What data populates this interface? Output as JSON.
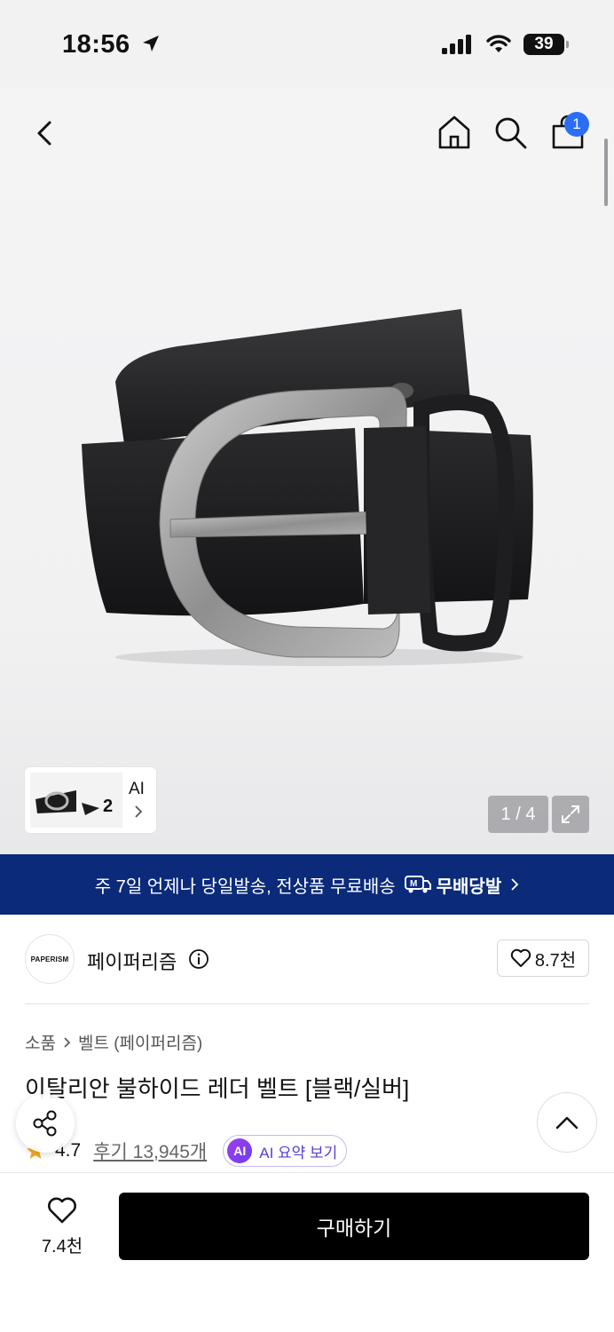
{
  "status_bar": {
    "time": "18:56",
    "battery": "39"
  },
  "header": {
    "back_icon": "chevron-left-icon",
    "home_icon": "home-icon",
    "search_icon": "search-icon",
    "cart_icon": "shopping-bag-icon",
    "cart_badge": "1"
  },
  "gallery": {
    "thumbnail_label": "AI",
    "page_indicator": "1 / 4",
    "expand_icon": "expand-icon"
  },
  "banner": {
    "text": "주 7일 언제나 당일발송, 전상품 무료배송",
    "logo_mark": "M",
    "logo_text": "무배당발",
    "bg_color": "#0b2a7a"
  },
  "brand": {
    "logo_text": "PAPERISM",
    "name": "페이퍼리즘",
    "like_count": "8.7천"
  },
  "breadcrumb": [
    "소품",
    "벨트 (페이퍼리즘)"
  ],
  "product": {
    "title": "이탈리안 불하이드 레더 벨트 [블랙/실버]",
    "rating": "4.7",
    "reviews": "후기 13,945개",
    "ai_badge": "AI",
    "ai_summary": "AI 요약 보기"
  },
  "bottom": {
    "wish_count": "7.4천",
    "buy_label": "구매하기"
  },
  "colors": {
    "accent_blue": "#2b6ef5",
    "star": "#f5a623",
    "ai_purple": "#6a3df0"
  }
}
